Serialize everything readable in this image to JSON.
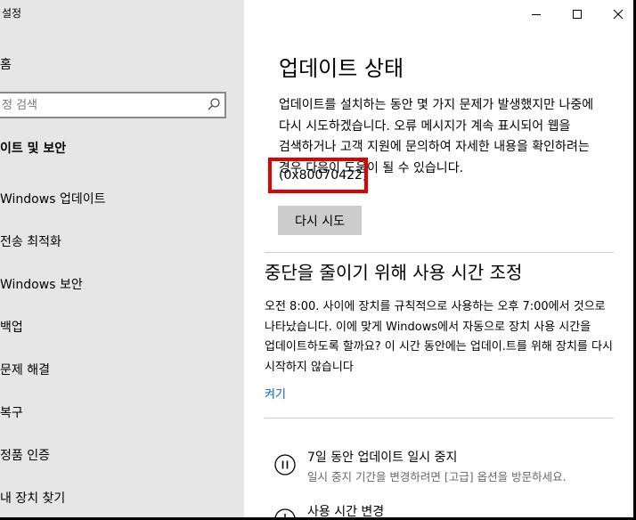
{
  "window": {
    "title": "설정",
    "controls": [
      "minimize",
      "maximize",
      "close"
    ]
  },
  "sidebar": {
    "home_label": "홈",
    "search": {
      "placeholder": "정 검색"
    },
    "section_header": "이트 및 보안",
    "items": [
      {
        "label": "Windows 업데이트"
      },
      {
        "label": "전송 최적화"
      },
      {
        "label": "Windows 보안"
      },
      {
        "label": "백업"
      },
      {
        "label": "문제 해결"
      },
      {
        "label": "복구"
      },
      {
        "label": "정품 인증"
      },
      {
        "label": "내 장치 찾기"
      }
    ]
  },
  "main": {
    "title": "업데이트 상태",
    "status_message": "업데이트를 설치하는 동안 몇 가지 문제가 발생했지만 나중에 다시 시도하겠습니다. 오류 메시지가 계속 표시되어 웹을 검색하거나 고객 지원에 문의하여 자세한 내용을 확인하려는 경우 다음이 도움이 될 수 있습니다.",
    "error_code": "(0x80070422)",
    "retry_button": "다시 시도",
    "active_hours": {
      "title": "중단을 줄이기 위해 사용 시간 조정",
      "message": "오전 8:00. 사이에 장치를 규칙적으로 사용하는 오후 7:00에서 것으로 나타났습니다. 이에 맞게 Windows에서 자동으로 장치 사용 시간을 업데이트하도록 할까요? 이 시간 동안에는 업데이.트를 위해 장치를 다시 시작하지 않습니다",
      "toggle_link": "켜기"
    },
    "options": [
      {
        "title": "7일 동안 업데이트 일시 중지",
        "description": "일시 중지 기간을 변경하려면 [고급] 옵션을 방문하세요.",
        "icon": "pause-icon"
      },
      {
        "title": "사용 시간 변경",
        "description": "",
        "icon": "clock-icon"
      }
    ]
  },
  "colors": {
    "sidebar_bg": "#e6e6e6",
    "button_bg": "#cccccc",
    "link": "#0063b1",
    "highlight_box": "#e30000"
  }
}
